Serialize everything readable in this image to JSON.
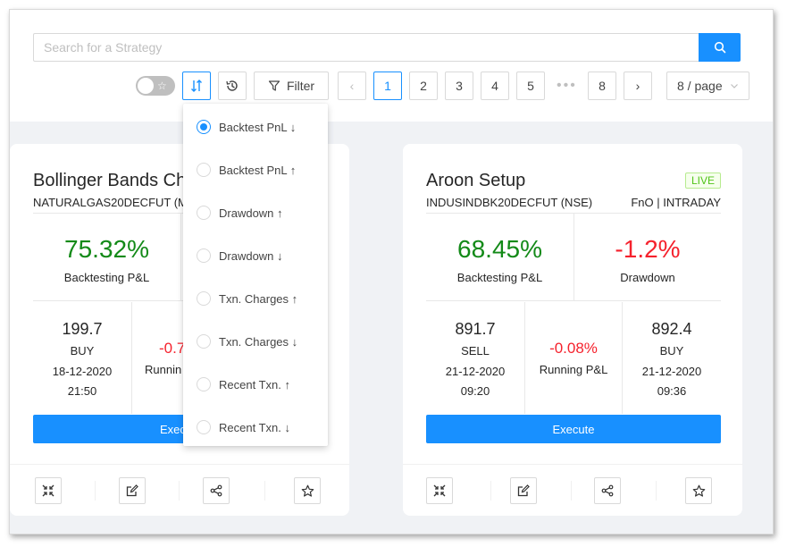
{
  "search": {
    "placeholder": "Search for a Strategy"
  },
  "toolbar": {
    "favorites_toggle_on": false,
    "filter_label": "Filter",
    "pages": [
      "1",
      "2",
      "3",
      "4",
      "5",
      "8"
    ],
    "current_page": "1",
    "ellipsis": "•••",
    "page_size": "8 / page"
  },
  "sort_menu": {
    "selected": "Backtest PnL ↓",
    "options": [
      "Backtest PnL ↓",
      "Backtest PnL ↑",
      "Drawdown ↑",
      "Drawdown ↓",
      "Txn. Charges ↑",
      "Txn. Charges ↓",
      "Recent Txn. ↑",
      "Recent Txn. ↓"
    ]
  },
  "cards": [
    {
      "title": "Bollinger Bands Ch",
      "badge": "",
      "symbol": "NATURALGAS20DECFUT (M",
      "segment": "",
      "backtest_pnl": "75.32%",
      "backtest_pnl_label": "Backtesting P&L",
      "drawdown": "",
      "drawdown_label": "",
      "entry_price": "199.7",
      "entry_side": "BUY",
      "entry_date": "18-12-2020",
      "entry_time": "21:50",
      "running_pnl": "-0.7",
      "running_pnl_label": "Runnin",
      "exit_price": "",
      "exit_side": "",
      "exit_date": "",
      "exit_time": "",
      "execute_label": "Exec"
    },
    {
      "title": "Aroon Setup",
      "badge": "LIVE",
      "symbol": "INDUSINDBK20DECFUT (NSE)",
      "segment": "FnO | INTRADAY",
      "backtest_pnl": "68.45%",
      "backtest_pnl_label": "Backtesting P&L",
      "drawdown": "-1.2%",
      "drawdown_label": "Drawdown",
      "entry_price": "891.7",
      "entry_side": "SELL",
      "entry_date": "21-12-2020",
      "entry_time": "09:20",
      "running_pnl": "-0.08%",
      "running_pnl_label": "Running P&L",
      "exit_price": "892.4",
      "exit_side": "BUY",
      "exit_date": "21-12-2020",
      "exit_time": "09:36",
      "execute_label": "Execute"
    }
  ],
  "colors": {
    "primary": "#1890ff",
    "profit": "#138a18",
    "loss": "#f5222d",
    "live": "#52c41a"
  }
}
